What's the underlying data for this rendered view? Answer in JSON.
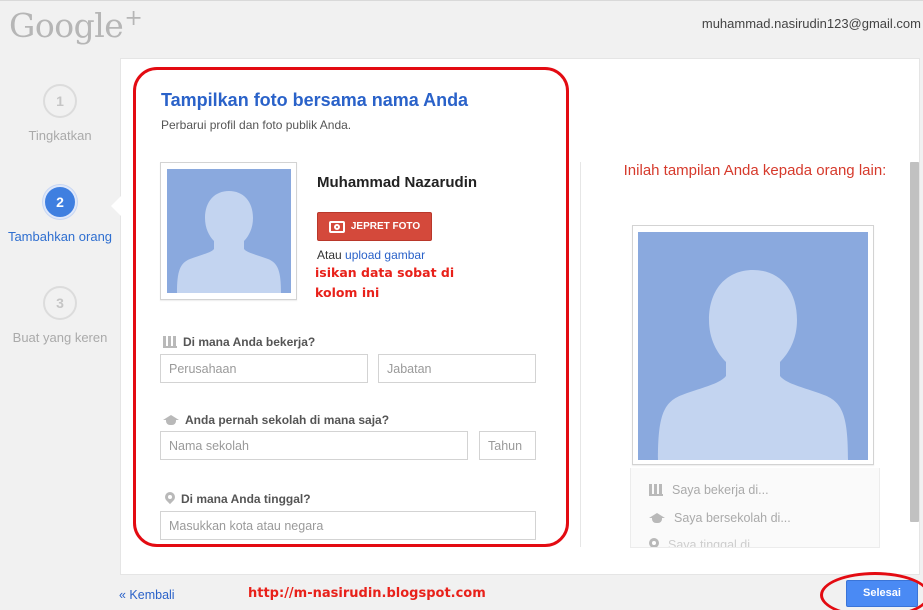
{
  "header": {
    "logo_text": "Google",
    "logo_plus": "+",
    "account_email": "muhammad.nasirudin123@gmail.com"
  },
  "steps": [
    {
      "number": "1",
      "label": "Tingkatkan",
      "active": false
    },
    {
      "number": "2",
      "label": "Tambahkan orang",
      "active": true
    },
    {
      "number": "3",
      "label": "Buat yang keren",
      "active": false
    }
  ],
  "form": {
    "title": "Tampilkan foto bersama nama Anda",
    "subtitle": "Perbarui profil dan foto publik Anda.",
    "profile_name": "Muhammad Nazarudin",
    "photo_button_label": "JEPRET FOTO",
    "upload_prefix": "Atau",
    "upload_link": "upload gambar",
    "annotation": "isikan data sobat di kolom ini",
    "work_question": "Di mana Anda bekerja?",
    "company_placeholder": "Perusahaan",
    "job_placeholder": "Jabatan",
    "school_question": "Anda pernah sekolah di mana saja?",
    "school_placeholder": "Nama sekolah",
    "year_placeholder": "Tahun",
    "live_question": "Di mana Anda tinggal?",
    "city_placeholder": "Masukkan kota atau negara"
  },
  "preview": {
    "title": "Inilah tampilan Anda kepada orang lain:",
    "items": [
      "Saya bekerja di...",
      "Saya bersekolah di...",
      "Saya tinggal di..."
    ]
  },
  "footer": {
    "back_label": "« Kembali",
    "blog_url": "http://m-nasirudin.blogspot.com",
    "finish_label": "Selesai"
  },
  "colors": {
    "accent_blue": "#2a62c9",
    "button_red": "#d4493b",
    "annotation_red": "#e30b12",
    "primary_button": "#4a8af4"
  }
}
